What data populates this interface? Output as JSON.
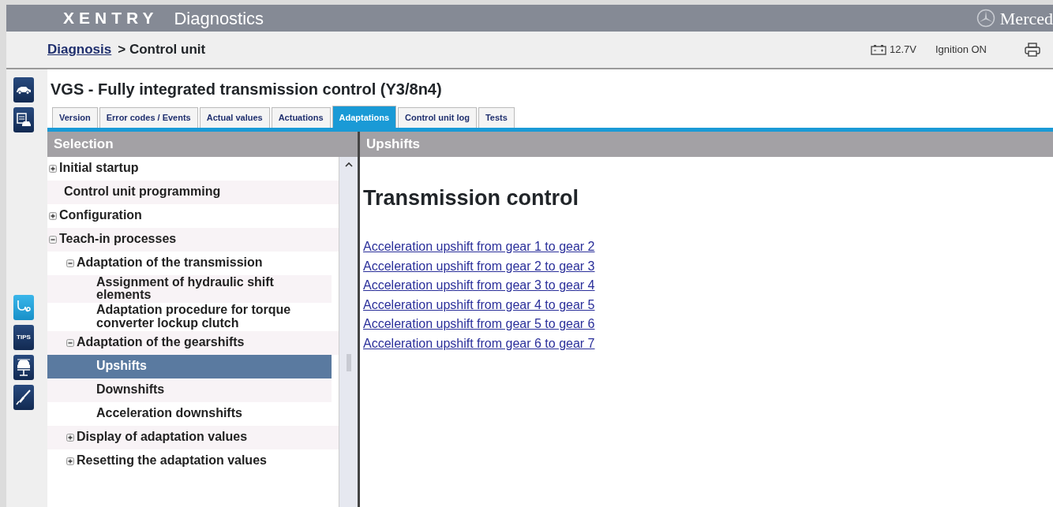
{
  "header": {
    "brand": "XENTRY",
    "app": "Diagnostics",
    "maker": "Merced"
  },
  "breadcrumb": {
    "link": "Diagnosis",
    "current": "> Control unit"
  },
  "status": {
    "voltage": "12.7V",
    "ignition": "Ignition ON"
  },
  "rail": [
    {
      "kind": "car"
    },
    {
      "kind": "car-doc"
    },
    {
      "kind": "stethoscope"
    },
    {
      "kind": "tips",
      "label": "TIPS"
    },
    {
      "kind": "lift"
    },
    {
      "kind": "tool"
    }
  ],
  "title": "VGS - Fully integrated transmission control (Y3/8n4)",
  "tabs": [
    {
      "label": "Version",
      "selected": false
    },
    {
      "label": "Error codes / Events",
      "selected": false
    },
    {
      "label": "Actual values",
      "selected": false
    },
    {
      "label": "Actuations",
      "selected": false
    },
    {
      "label": "Adaptations",
      "selected": true
    },
    {
      "label": "Control unit log",
      "selected": false
    },
    {
      "label": "Tests",
      "selected": false
    }
  ],
  "selection": {
    "title": "Selection",
    "items": [
      {
        "label": "Initial startup",
        "kind": "folder",
        "expanded": false,
        "selected": false
      },
      {
        "label": "Control unit programming",
        "kind": "leaf",
        "selected": false
      },
      {
        "label": "Configuration",
        "kind": "folder",
        "expanded": false,
        "selected": false
      },
      {
        "label": "Teach-in processes",
        "kind": "folder",
        "expanded": true,
        "selected": false,
        "children": [
          {
            "label": "Adaptation of the transmission",
            "kind": "folder",
            "expanded": true,
            "selected": false,
            "children": [
              {
                "label": "Assignment of hydraulic shift elements",
                "kind": "leaf",
                "selected": false
              },
              {
                "label": "Adaptation procedure for torque converter lockup clutch",
                "kind": "leaf",
                "selected": false
              }
            ]
          },
          {
            "label": "Adaptation of the gearshifts",
            "kind": "folder",
            "expanded": true,
            "selected": false,
            "children": [
              {
                "label": "Upshifts",
                "kind": "leaf",
                "selected": true
              },
              {
                "label": "Downshifts",
                "kind": "leaf",
                "selected": false
              },
              {
                "label": "Acceleration downshifts",
                "kind": "leaf",
                "selected": false
              }
            ]
          },
          {
            "label": "Display of adaptation values",
            "kind": "folder",
            "expanded": false,
            "selected": false
          },
          {
            "label": "Resetting the adaptation values",
            "kind": "folder",
            "expanded": false,
            "selected": false
          }
        ]
      }
    ]
  },
  "content": {
    "title": "Upshifts",
    "heading": "Transmission control",
    "links": [
      "Acceleration upshift from gear 1 to gear 2",
      "Acceleration upshift from gear 2 to gear 3",
      "Acceleration upshift from gear 3 to gear 4",
      "Acceleration upshift from gear 4 to gear 5",
      "Acceleration upshift from gear 5 to gear 6",
      "Acceleration upshift from gear 6 to gear 7"
    ]
  }
}
